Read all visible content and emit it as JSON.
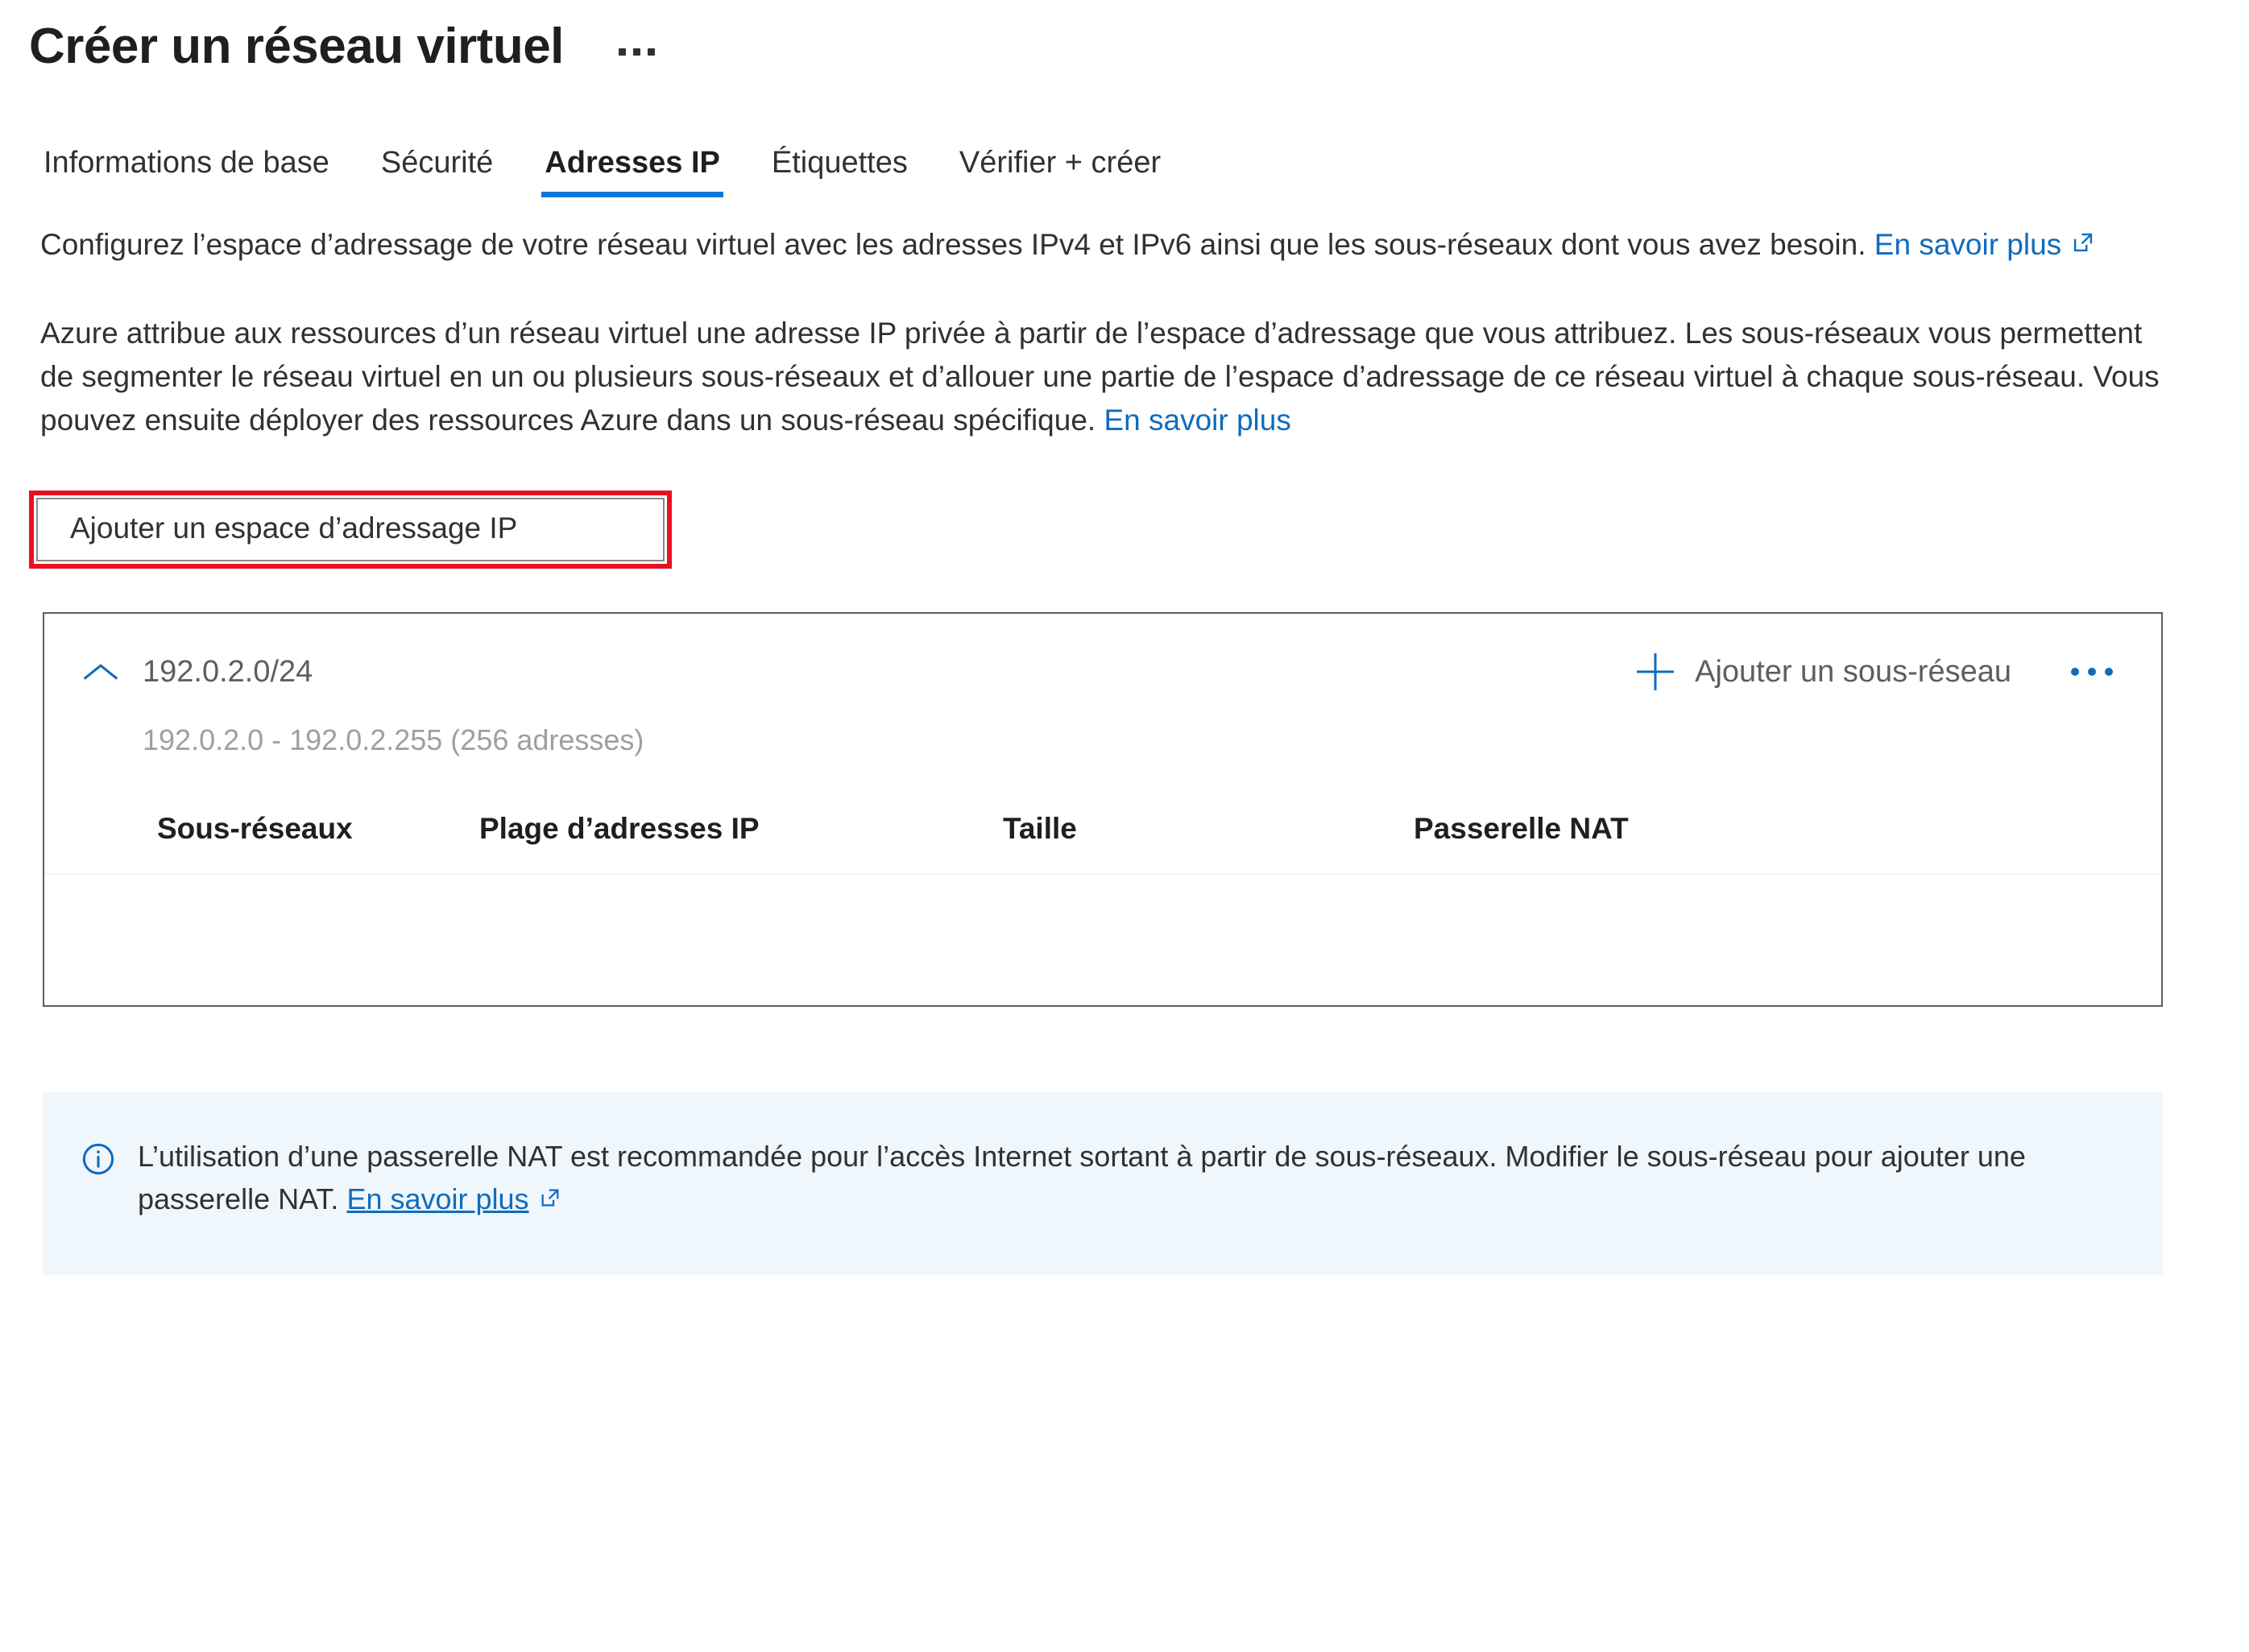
{
  "header": {
    "title": "Créer un réseau virtuel",
    "more_menu_icon": "ellipsis-icon"
  },
  "tabs": [
    {
      "label": "Informations de base",
      "active": false
    },
    {
      "label": "Sécurité",
      "active": false
    },
    {
      "label": "Adresses IP",
      "active": true
    },
    {
      "label": "Étiquettes",
      "active": false
    },
    {
      "label": "Vérifier + créer",
      "active": false
    }
  ],
  "intro": {
    "paragraph1": "Configurez l’espace d’adressage de votre réseau virtuel avec les adresses IPv4 et IPv6 ainsi que les sous-réseaux dont vous avez besoin.",
    "paragraph1_link": "En savoir plus",
    "paragraph2": "Azure attribue aux ressources d’un réseau virtuel une adresse IP privée à partir de l’espace d’adressage que vous attribuez. Les sous-réseaux vous permettent de segmenter le réseau virtuel en un ou plusieurs sous-réseaux et d’allouer une partie de l’espace d’adressage de ce réseau virtuel à chaque sous-réseau. Vous pouvez ensuite déployer des ressources Azure dans un sous-réseau spécifique.",
    "paragraph2_link": "En savoir plus"
  },
  "actions": {
    "add_address_space": "Ajouter un espace d’adressage IP"
  },
  "address_space": {
    "collapse_icon": "chevron-up-icon",
    "cidr": "192.0.2.0/24",
    "add_subnet_label": "Ajouter un sous-réseau",
    "add_subnet_icon": "plus-icon",
    "context_menu_icon": "ellipsis-icon",
    "range": "192.0.2.0 - 192.0.2.255 (256 adresses)",
    "table": {
      "columns": [
        "Sous-réseaux",
        "Plage d’adresses IP",
        "Taille",
        "Passerelle NAT"
      ],
      "rows": []
    }
  },
  "info_banner": {
    "icon": "info-circle-icon",
    "text": "L’utilisation d’une passerelle NAT est recommandée pour l’accès Internet sortant à partir de sous-réseaux. Modifier le sous-réseau pour ajouter une passerelle NAT.",
    "link": "En savoir plus"
  },
  "colors": {
    "accent_blue": "#0078d4",
    "link_blue": "#0f6cbd",
    "annotation_red": "#e81123",
    "banner_bg": "#eff6fc",
    "text_primary": "#323130",
    "text_secondary": "#605e5c",
    "text_muted": "#a19f9d"
  }
}
